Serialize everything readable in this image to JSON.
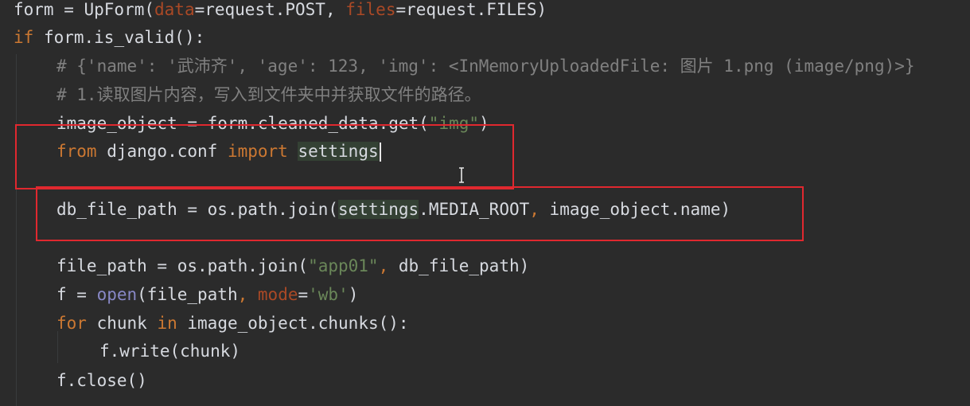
{
  "code": {
    "line1": {
      "t1": "form = UpForm(",
      "t2": "data",
      "t3": "=request.POST, ",
      "t4": "files",
      "t5": "=request.FILES)"
    },
    "line2": {
      "t1": "if",
      "t2": " form.is_valid():"
    },
    "line3": {
      "t1": "# {'name': '武沛齐', 'age': 123, 'img': <InMemoryUploadedFile: 图片 1.png (image/png)>}"
    },
    "line4": {
      "t1": "# 1.读取图片内容，写入到文件夹中并获取文件的路径。"
    },
    "line5": {
      "t1": "image_object = form.cleaned_data.get(",
      "t2": "\"img\"",
      "t3": ")"
    },
    "line6": {
      "t1": "from",
      "t2": " django.conf ",
      "t3": "import",
      "t4": " ",
      "t5": "settings"
    },
    "line7": {
      "t1": "db_file_path = os.path.join(",
      "t2": "settings",
      "t3": ".MEDIA_ROOT",
      "t4": ",",
      "t5": " image_object.name)"
    },
    "line8": {
      "t1": "file_path = os.path.join(",
      "t2": "\"app01\"",
      "t3": ",",
      "t4": " db_file_path)"
    },
    "line9": {
      "t1": "f = ",
      "t2": "open",
      "t3": "(file_path",
      "t4": ",",
      "t5": " ",
      "t6": "mode",
      "t7": "=",
      "t8": "'wb'",
      "t9": ")"
    },
    "line10": {
      "t1": "for",
      "t2": " chunk ",
      "t3": "in",
      "t4": " image_object.chunks():"
    },
    "line11": {
      "t1": "f.write(chunk)"
    },
    "line12": {
      "t1": "f.close()"
    }
  },
  "colors": {
    "background": "#2b2b2b",
    "keyword": "#cc7832",
    "string": "#6a8759",
    "comment": "#808080",
    "param": "#aa4926",
    "builtin": "#8888c6",
    "highlight_box": "#e0282f"
  },
  "cursor": {
    "icon": "text-cursor-ibeam-icon"
  }
}
